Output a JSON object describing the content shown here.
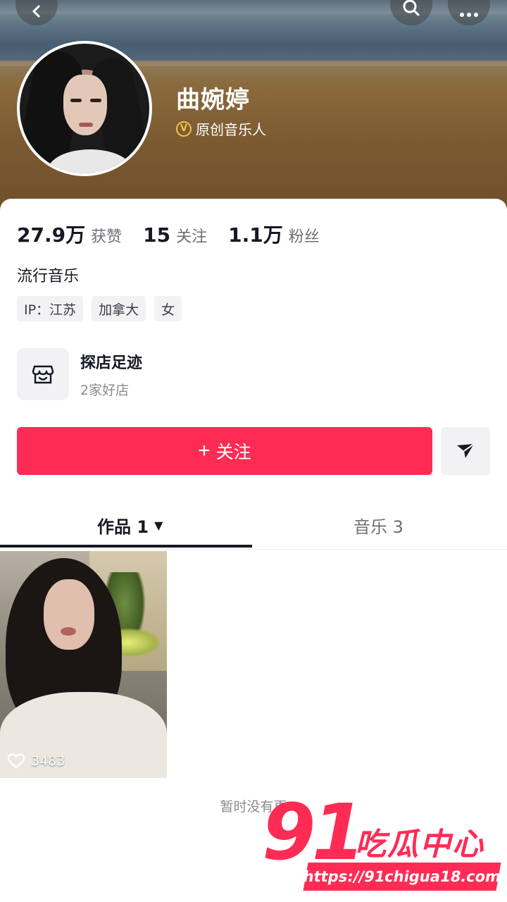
{
  "profile": {
    "name": "曲婉婷",
    "verify_badge": "V",
    "verified_label": "原创音乐人",
    "bio": "流行音乐"
  },
  "stats": [
    {
      "value": "27.9万",
      "label": "获赞"
    },
    {
      "value": "15",
      "label": "关注"
    },
    {
      "value": "1.1万",
      "label": "粉丝"
    }
  ],
  "tags": [
    "IP：江苏",
    "加拿大",
    "女"
  ],
  "shop": {
    "title": "探店足迹",
    "subtitle": "2家好店",
    "icon": "shop-icon"
  },
  "actions": {
    "follow_plus": "+",
    "follow_label": "关注",
    "share_icon": "send-icon"
  },
  "tabs": {
    "works_label": "作品 1",
    "works_arrow": "▼",
    "music_label": "音乐 3"
  },
  "videos": [
    {
      "likes": "3483"
    }
  ],
  "footer": {
    "no_more": "暂时没有更"
  },
  "watermark": {
    "number": "91",
    "text": "吃瓜中心",
    "url": "https://91chigua18.com"
  },
  "colors": {
    "accent": "#fe2c55",
    "badge": "#f5c242"
  }
}
